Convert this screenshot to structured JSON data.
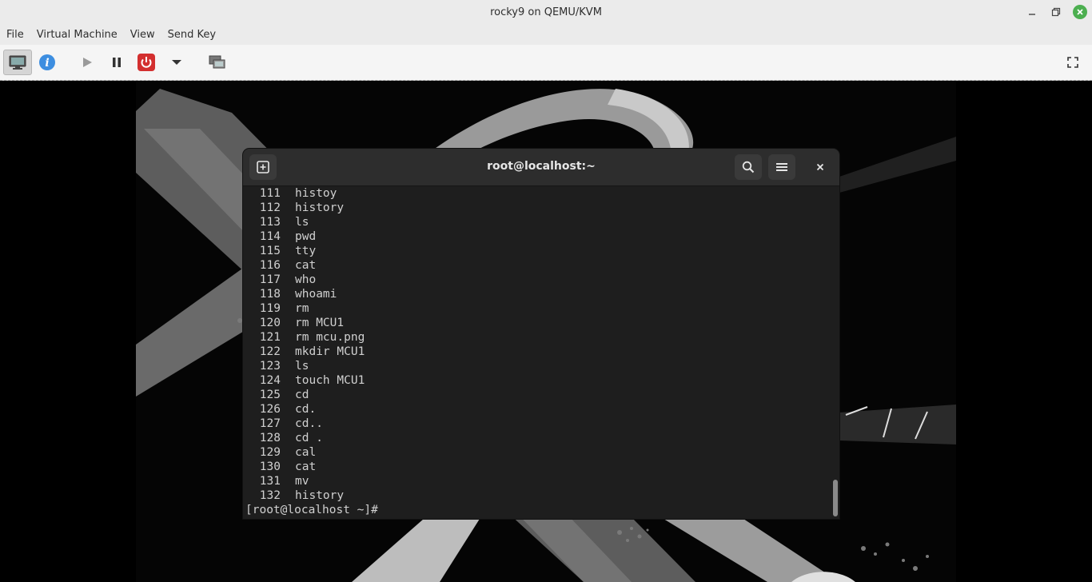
{
  "window": {
    "title": "rocky9 on QEMU/KVM"
  },
  "menubar": {
    "items": [
      "File",
      "Virtual Machine",
      "View",
      "Send Key"
    ]
  },
  "toolbar": {
    "buttons": [
      "console-icon",
      "info-icon",
      "run-icon",
      "pause-icon",
      "power-icon",
      "dropdown-arrow-icon",
      "snapshots-icon",
      "fullscreen-icon"
    ]
  },
  "colors": {
    "power": "#d32f2f",
    "info": "#3d8ee0",
    "close_green": "#4caf50",
    "terminal_bg": "#1e1e1e"
  },
  "terminal": {
    "title": "root@localhost:~",
    "history": [
      {
        "num": "111",
        "cmd": "histoy"
      },
      {
        "num": "112",
        "cmd": "history"
      },
      {
        "num": "113",
        "cmd": "ls"
      },
      {
        "num": "114",
        "cmd": "pwd"
      },
      {
        "num": "115",
        "cmd": "tty"
      },
      {
        "num": "116",
        "cmd": "cat"
      },
      {
        "num": "117",
        "cmd": "who"
      },
      {
        "num": "118",
        "cmd": "whoami"
      },
      {
        "num": "119",
        "cmd": "rm"
      },
      {
        "num": "120",
        "cmd": "rm MCU1"
      },
      {
        "num": "121",
        "cmd": "rm mcu.png"
      },
      {
        "num": "122",
        "cmd": "mkdir MCU1"
      },
      {
        "num": "123",
        "cmd": "ls"
      },
      {
        "num": "124",
        "cmd": "touch MCU1"
      },
      {
        "num": "125",
        "cmd": "cd"
      },
      {
        "num": "126",
        "cmd": "cd."
      },
      {
        "num": "127",
        "cmd": "cd.."
      },
      {
        "num": "128",
        "cmd": "cd ."
      },
      {
        "num": "129",
        "cmd": "cal"
      },
      {
        "num": "130",
        "cmd": "cat"
      },
      {
        "num": "131",
        "cmd": "mv"
      },
      {
        "num": "132",
        "cmd": "history"
      }
    ],
    "prompt": "[root@localhost ~]#"
  }
}
